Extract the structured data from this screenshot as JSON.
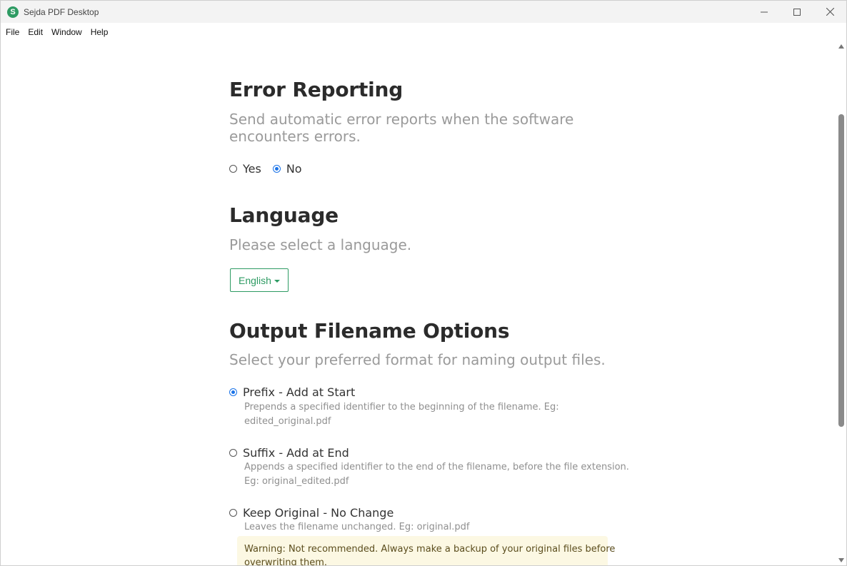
{
  "window": {
    "title": "Sejda PDF Desktop",
    "logo_letter": "S",
    "accent_color": "#2e9b63",
    "controls": [
      "minimize",
      "maximize",
      "close"
    ]
  },
  "menu": [
    "File",
    "Edit",
    "Window",
    "Help"
  ],
  "error_reporting": {
    "heading": "Error Reporting",
    "description_line1": "Send automatic error reports when the software",
    "description_line2": "encounters errors.",
    "options": [
      {
        "label": "Yes",
        "selected": false
      },
      {
        "label": "No",
        "selected": true
      }
    ]
  },
  "language": {
    "heading": "Language",
    "description": "Please select a language.",
    "selected": "English"
  },
  "output_filename": {
    "heading": "Output Filename Options",
    "description": "Select your preferred format for naming output files.",
    "options": [
      {
        "label": "Prefix - Add at Start",
        "desc_line1": "Prepends a specified identifier to the beginning of the filename. Eg:",
        "desc_line2": "edited_original.pdf",
        "selected": true
      },
      {
        "label": "Suffix - Add at End",
        "desc_line1": "Appends a specified identifier to the end of the filename, before the file extension.",
        "desc_line2": "Eg: original_edited.pdf",
        "selected": false
      },
      {
        "label": "Keep Original - No Change",
        "desc_line1": "Leaves the filename unchanged. Eg: original.pdf",
        "selected": false
      }
    ],
    "warning_line1": "Warning: Not recommended. Always make a backup of your original files before",
    "warning_line2": "overwriting them."
  }
}
